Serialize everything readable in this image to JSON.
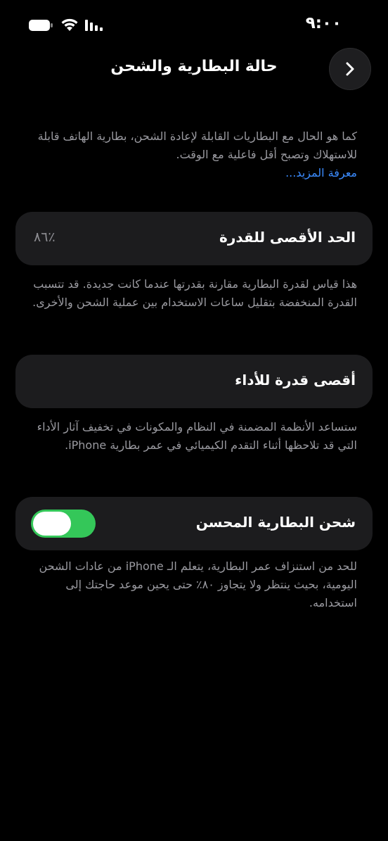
{
  "status_bar": {
    "time": "٩:٠٠"
  },
  "nav": {
    "title": "حالة البطارية والشحن",
    "back_icon": "chevron-right-icon"
  },
  "intro": {
    "text": "كما هو الحال مع البطاريات القابلة لإعادة الشحن، بطارية الهاتف قابلة للاستهلاك وتصبح أقل فاعلية مع الوقت.",
    "link": "معرفة المزيد..."
  },
  "maximum_capacity": {
    "label": "الحد الأقصى للقدرة",
    "value": "٪٨٦",
    "description": "هذا قياس لقدرة البطارية مقارنة بقدرتها عندما كانت جديدة. قد تتسبب القدرة المنخفضة بتقليل ساعات الاستخدام بين عملية الشحن والأخرى."
  },
  "peak_performance": {
    "label": "أقصى قدرة للأداء",
    "description": "ستساعد الأنظمة المضمنة في النظام والمكونات في تخفيف آثار الأداء التي قد تلاحظها أثناء التقدم الكيميائي في عمر بطارية iPhone."
  },
  "optimized_charging": {
    "label": "شحن البطارية المحسن",
    "enabled": true,
    "description": "للحد من استنزاف عمر البطارية، يتعلم الـ iPhone من عادات الشحن اليومية، بحيث ينتظر ولا يتجاوز ٨٠٪ حتى يحين موعد حاجتك إلى استخدامه."
  },
  "colors": {
    "background": "#000000",
    "card": "#1c1c1e",
    "link": "#3b8cff",
    "toggle_on": "#34c759",
    "secondary_text": "#9a9aa0"
  }
}
